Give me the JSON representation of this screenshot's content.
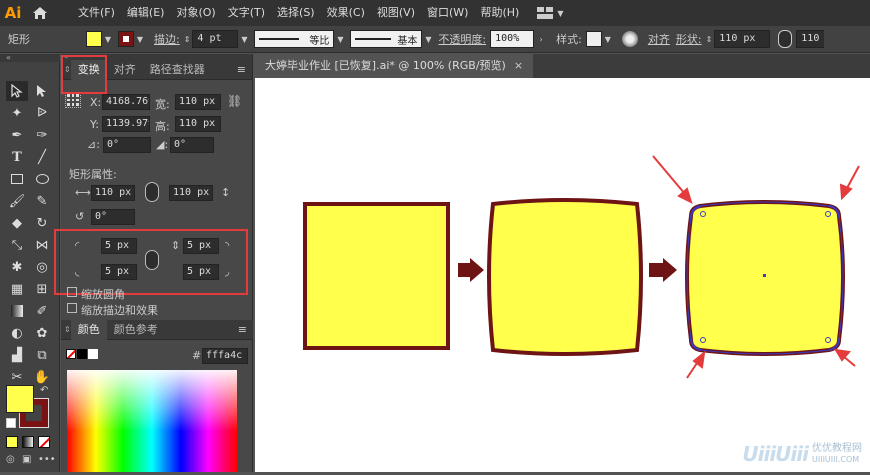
{
  "app": {
    "logo": "Ai",
    "menu": [
      "文件(F)",
      "编辑(E)",
      "对象(O)",
      "文字(T)",
      "选择(S)",
      "效果(C)",
      "视图(V)",
      "窗口(W)",
      "帮助(H)"
    ]
  },
  "control": {
    "selection_label": "矩形",
    "stroke_label": "描边:",
    "stroke_value": "4 pt",
    "profile_label": "等比",
    "brush_label": "基本",
    "opacity_label": "不透明度:",
    "opacity_value": "100%",
    "style_label": "样式:",
    "align_label": "对齐",
    "shape_label": "形状:",
    "width_value": "110 px",
    "width_value2": "110",
    "fill_color": "#ffff4c",
    "stroke_color": "#7a1414"
  },
  "panel": {
    "tabs": [
      "变换",
      "对齐",
      "路径查找器"
    ],
    "x_label": "X:",
    "x_value": "4168.769",
    "y_label": "Y:",
    "y_value": "1139.979",
    "w_label": "宽:",
    "w_value": "110 px",
    "h_label": "高:",
    "h_value": "110 px",
    "angle_value": "0°",
    "shear_value": "0°",
    "rect_props_label": "矩形属性:",
    "rect_w": "110 px",
    "rect_h": "110 px",
    "rect_angle": "0°",
    "corner_tl": "5 px",
    "corner_tr": "5 px",
    "corner_bl": "5 px",
    "corner_br": "5 px",
    "scale_corners": "缩放圆角",
    "scale_strokes": "缩放描边和效果"
  },
  "color_panel": {
    "tabs": [
      "颜色",
      "颜色参考"
    ],
    "hex_prefix": "#",
    "hex_value": "fffa4c"
  },
  "document": {
    "tab_title": "大婷毕业作业 [已恢复].ai* @ 100% (RGB/预览)"
  },
  "watermark": {
    "brand": "UiiiUiii",
    "brand_cn": "优优教程网",
    "url": "UIIIUIII.COM"
  },
  "colors": {
    "fill": "#ffff4c",
    "stroke": "#6e1414",
    "arrow": "#6e1414",
    "annotation": "#e43c3c",
    "anchor": "#3030a8"
  }
}
